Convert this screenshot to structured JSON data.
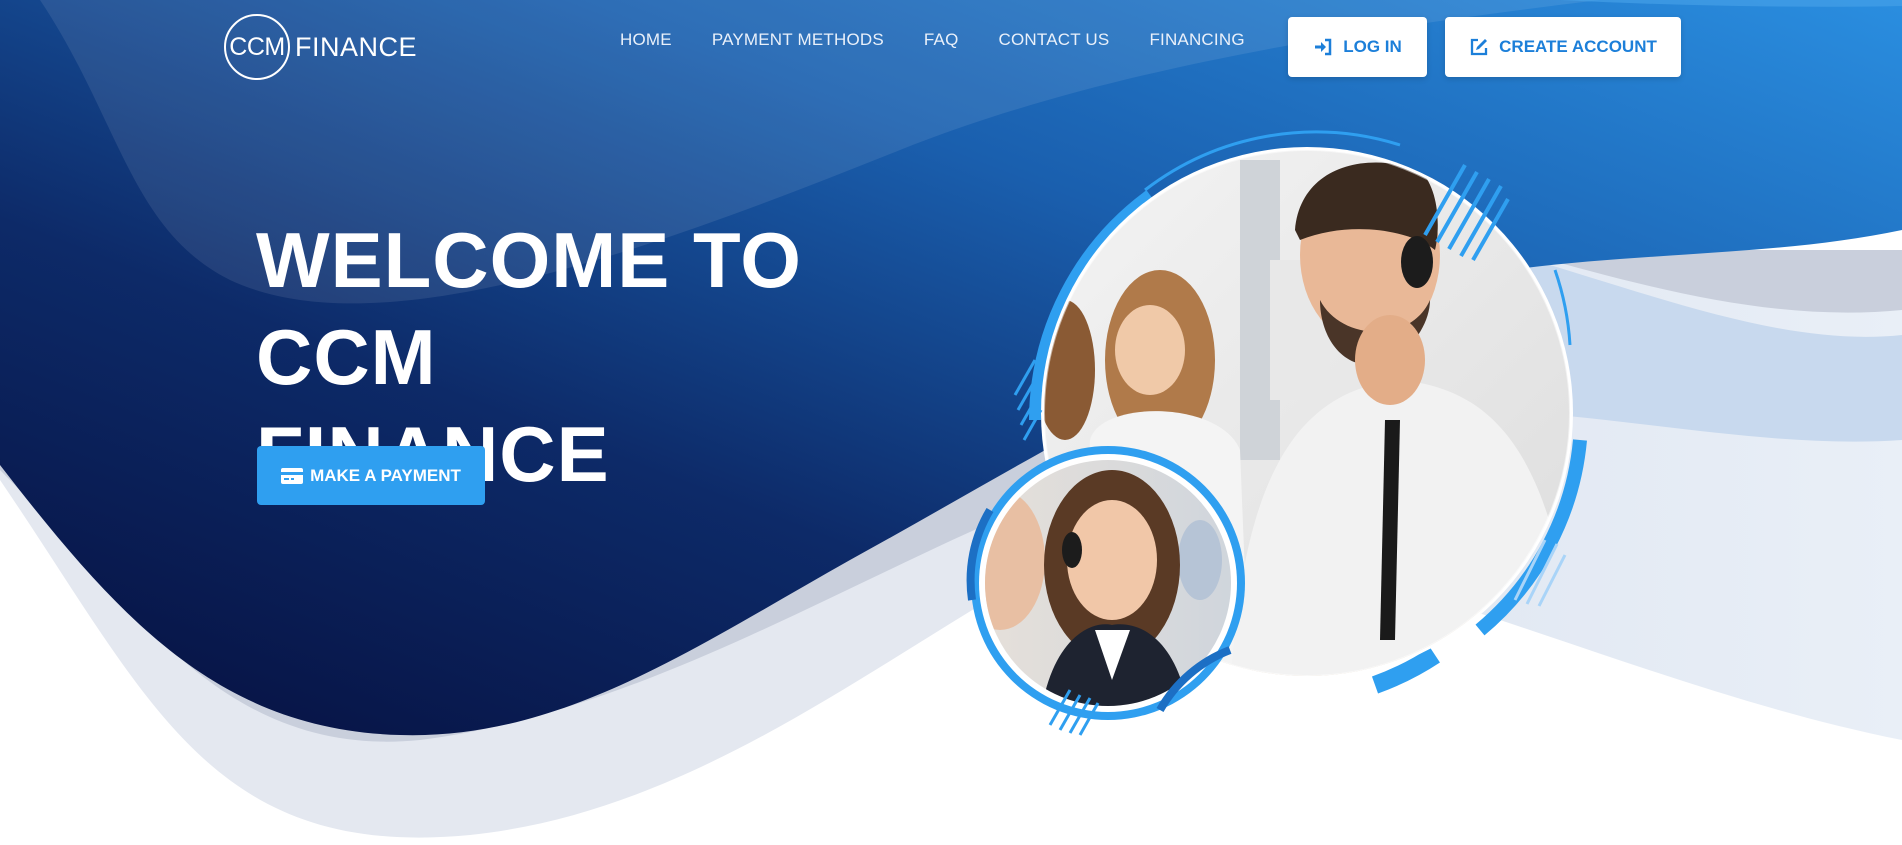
{
  "brand": {
    "logo_mark": "CCM",
    "logo_word": "FINANCE"
  },
  "nav": {
    "items": [
      {
        "label": "HOME"
      },
      {
        "label": "PAYMENT METHODS"
      },
      {
        "label": "FAQ"
      },
      {
        "label": "CONTACT US"
      },
      {
        "label": "FINANCING"
      }
    ]
  },
  "auth": {
    "login_label": "LOG IN",
    "login_icon": "sign-in-icon",
    "create_label": "CREATE ACCOUNT",
    "create_icon": "edit-icon"
  },
  "hero": {
    "title_line1": "WELCOME TO CCM",
    "title_line2": "FINANCE",
    "cta_label": "MAKE A PAYMENT",
    "cta_icon": "credit-card-icon"
  },
  "images": {
    "main_photo": "call-center-agent-man-photo",
    "secondary_photo": "call-center-agent-woman-photo"
  },
  "colors": {
    "accent": "#2f9ff0",
    "navy": "#0a1a4e",
    "blue": "#1c6fc4",
    "button_text": "#1c7fd9"
  }
}
